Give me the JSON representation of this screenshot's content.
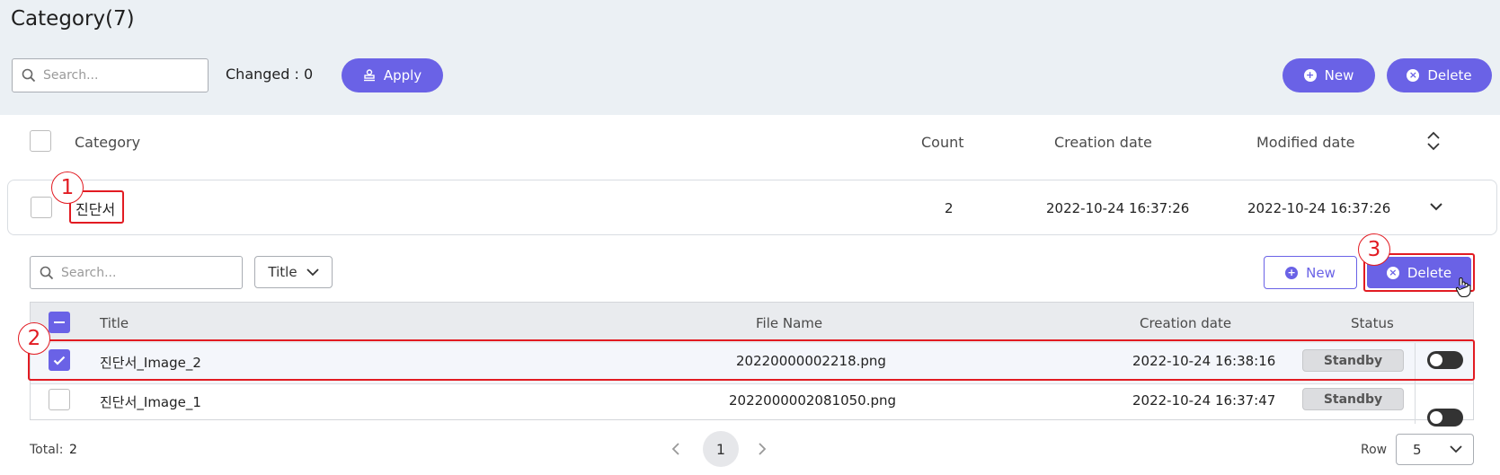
{
  "header": {
    "title": "Category(7)",
    "search_placeholder": "Search...",
    "changed_text": "Changed : 0",
    "apply_label": "Apply",
    "new_label": "New",
    "delete_label": "Delete"
  },
  "category_table": {
    "columns": [
      "Category",
      "Count",
      "Creation date",
      "Modified date"
    ],
    "rows": [
      {
        "category": "진단서",
        "count": "2",
        "creation_date": "2022-10-24 16:37:26",
        "modified_date": "2022-10-24 16:37:26"
      }
    ]
  },
  "sub_toolbar": {
    "search_placeholder": "Search...",
    "filter_value": "Title",
    "new_label": "New",
    "delete_label": "Delete"
  },
  "image_table": {
    "columns": [
      "Title",
      "File Name",
      "Creation date",
      "Status"
    ],
    "rows": [
      {
        "title": "진단서_Image_2",
        "file_name": "20220000002218.png",
        "creation_date": "2022-10-24 16:38:16",
        "status": "Standby",
        "checked": true
      },
      {
        "title": "진단서_Image_1",
        "file_name": "2022000002081050.png",
        "creation_date": "2022-10-24 16:37:47",
        "status": "Standby",
        "checked": false
      }
    ]
  },
  "footer": {
    "total_label": "Total:",
    "total_value": "2",
    "current_page": "1",
    "row_label": "Row",
    "row_value": "5"
  },
  "annotations": [
    "1",
    "2",
    "3"
  ],
  "colors": {
    "accent": "#6a62e6",
    "highlight": "#e21b22",
    "top_bg": "#ebf0f4"
  }
}
